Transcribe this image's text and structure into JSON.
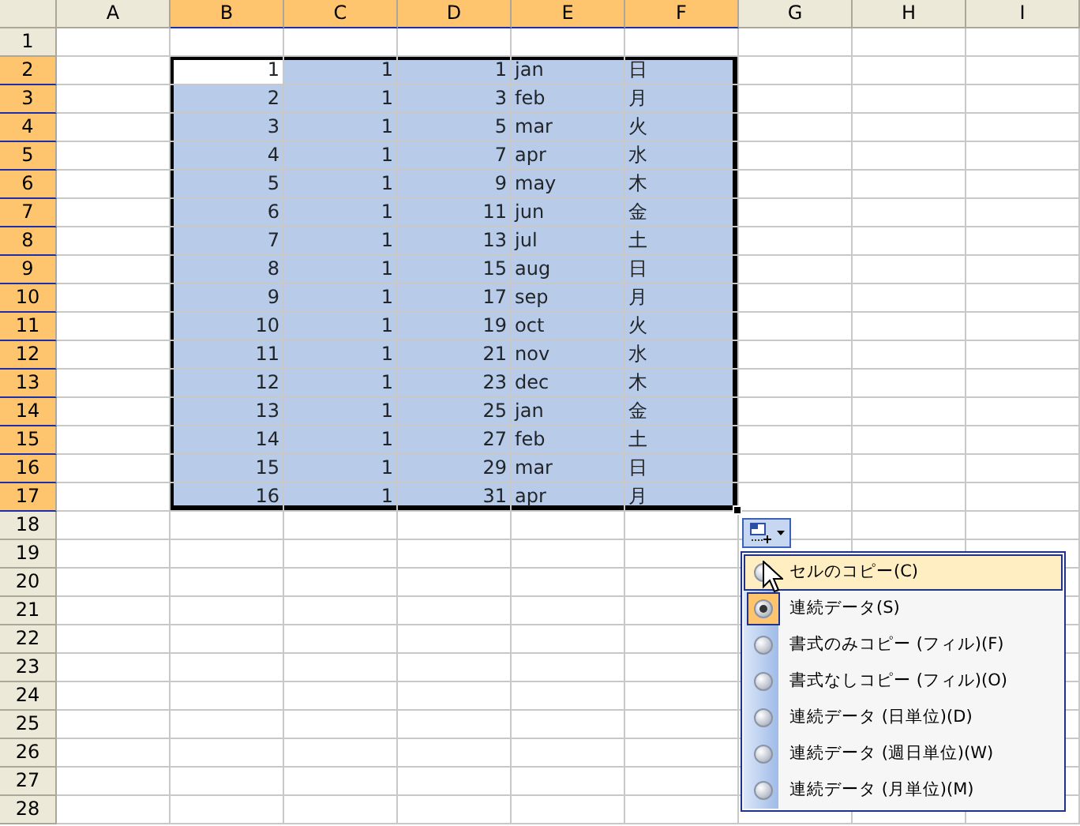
{
  "columns": [
    {
      "label": "A",
      "selected": false
    },
    {
      "label": "B",
      "selected": true
    },
    {
      "label": "C",
      "selected": true
    },
    {
      "label": "D",
      "selected": true
    },
    {
      "label": "E",
      "selected": true
    },
    {
      "label": "F",
      "selected": true
    },
    {
      "label": "G",
      "selected": false
    },
    {
      "label": "H",
      "selected": false
    },
    {
      "label": "I",
      "selected": false
    }
  ],
  "rows": [
    {
      "label": "1",
      "selected": false
    },
    {
      "label": "2",
      "selected": true,
      "cells": [
        {
          "text": "1",
          "kind": "number",
          "selected": true,
          "active": true
        },
        {
          "text": "1",
          "kind": "number",
          "selected": true,
          "active": false
        },
        {
          "text": "1",
          "kind": "number",
          "selected": true,
          "active": false
        },
        {
          "text": "jan",
          "kind": "text",
          "selected": true,
          "active": false
        },
        {
          "text": "日",
          "kind": "text",
          "selected": true,
          "active": false
        }
      ]
    },
    {
      "label": "3",
      "selected": true,
      "cells": [
        {
          "text": "2",
          "kind": "number",
          "selected": true,
          "active": false
        },
        {
          "text": "1",
          "kind": "number",
          "selected": true,
          "active": false
        },
        {
          "text": "3",
          "kind": "number",
          "selected": true,
          "active": false
        },
        {
          "text": "feb",
          "kind": "text",
          "selected": true,
          "active": false
        },
        {
          "text": "月",
          "kind": "text",
          "selected": true,
          "active": false
        }
      ]
    },
    {
      "label": "4",
      "selected": true,
      "cells": [
        {
          "text": "3",
          "kind": "number",
          "selected": true,
          "active": false
        },
        {
          "text": "1",
          "kind": "number",
          "selected": true,
          "active": false
        },
        {
          "text": "5",
          "kind": "number",
          "selected": true,
          "active": false
        },
        {
          "text": "mar",
          "kind": "text",
          "selected": true,
          "active": false
        },
        {
          "text": "火",
          "kind": "text",
          "selected": true,
          "active": false
        }
      ]
    },
    {
      "label": "5",
      "selected": true,
      "cells": [
        {
          "text": "4",
          "kind": "number",
          "selected": true,
          "active": false
        },
        {
          "text": "1",
          "kind": "number",
          "selected": true,
          "active": false
        },
        {
          "text": "7",
          "kind": "number",
          "selected": true,
          "active": false
        },
        {
          "text": "apr",
          "kind": "text",
          "selected": true,
          "active": false
        },
        {
          "text": "水",
          "kind": "text",
          "selected": true,
          "active": false
        }
      ]
    },
    {
      "label": "6",
      "selected": true,
      "cells": [
        {
          "text": "5",
          "kind": "number",
          "selected": true,
          "active": false
        },
        {
          "text": "1",
          "kind": "number",
          "selected": true,
          "active": false
        },
        {
          "text": "9",
          "kind": "number",
          "selected": true,
          "active": false
        },
        {
          "text": "may",
          "kind": "text",
          "selected": true,
          "active": false
        },
        {
          "text": "木",
          "kind": "text",
          "selected": true,
          "active": false
        }
      ]
    },
    {
      "label": "7",
      "selected": true,
      "cells": [
        {
          "text": "6",
          "kind": "number",
          "selected": true,
          "active": false
        },
        {
          "text": "1",
          "kind": "number",
          "selected": true,
          "active": false
        },
        {
          "text": "11",
          "kind": "number",
          "selected": true,
          "active": false
        },
        {
          "text": "jun",
          "kind": "text",
          "selected": true,
          "active": false
        },
        {
          "text": "金",
          "kind": "text",
          "selected": true,
          "active": false
        }
      ]
    },
    {
      "label": "8",
      "selected": true,
      "cells": [
        {
          "text": "7",
          "kind": "number",
          "selected": true,
          "active": false
        },
        {
          "text": "1",
          "kind": "number",
          "selected": true,
          "active": false
        },
        {
          "text": "13",
          "kind": "number",
          "selected": true,
          "active": false
        },
        {
          "text": "jul",
          "kind": "text",
          "selected": true,
          "active": false
        },
        {
          "text": "土",
          "kind": "text",
          "selected": true,
          "active": false
        }
      ]
    },
    {
      "label": "9",
      "selected": true,
      "cells": [
        {
          "text": "8",
          "kind": "number",
          "selected": true,
          "active": false
        },
        {
          "text": "1",
          "kind": "number",
          "selected": true,
          "active": false
        },
        {
          "text": "15",
          "kind": "number",
          "selected": true,
          "active": false
        },
        {
          "text": "aug",
          "kind": "text",
          "selected": true,
          "active": false
        },
        {
          "text": "日",
          "kind": "text",
          "selected": true,
          "active": false
        }
      ]
    },
    {
      "label": "10",
      "selected": true,
      "cells": [
        {
          "text": "9",
          "kind": "number",
          "selected": true,
          "active": false
        },
        {
          "text": "1",
          "kind": "number",
          "selected": true,
          "active": false
        },
        {
          "text": "17",
          "kind": "number",
          "selected": true,
          "active": false
        },
        {
          "text": "sep",
          "kind": "text",
          "selected": true,
          "active": false
        },
        {
          "text": "月",
          "kind": "text",
          "selected": true,
          "active": false
        }
      ]
    },
    {
      "label": "11",
      "selected": true,
      "cells": [
        {
          "text": "10",
          "kind": "number",
          "selected": true,
          "active": false
        },
        {
          "text": "1",
          "kind": "number",
          "selected": true,
          "active": false
        },
        {
          "text": "19",
          "kind": "number",
          "selected": true,
          "active": false
        },
        {
          "text": "oct",
          "kind": "text",
          "selected": true,
          "active": false
        },
        {
          "text": "火",
          "kind": "text",
          "selected": true,
          "active": false
        }
      ]
    },
    {
      "label": "12",
      "selected": true,
      "cells": [
        {
          "text": "11",
          "kind": "number",
          "selected": true,
          "active": false
        },
        {
          "text": "1",
          "kind": "number",
          "selected": true,
          "active": false
        },
        {
          "text": "21",
          "kind": "number",
          "selected": true,
          "active": false
        },
        {
          "text": "nov",
          "kind": "text",
          "selected": true,
          "active": false
        },
        {
          "text": "水",
          "kind": "text",
          "selected": true,
          "active": false
        }
      ]
    },
    {
      "label": "13",
      "selected": true,
      "cells": [
        {
          "text": "12",
          "kind": "number",
          "selected": true,
          "active": false
        },
        {
          "text": "1",
          "kind": "number",
          "selected": true,
          "active": false
        },
        {
          "text": "23",
          "kind": "number",
          "selected": true,
          "active": false
        },
        {
          "text": "dec",
          "kind": "text",
          "selected": true,
          "active": false
        },
        {
          "text": "木",
          "kind": "text",
          "selected": true,
          "active": false
        }
      ]
    },
    {
      "label": "14",
      "selected": true,
      "cells": [
        {
          "text": "13",
          "kind": "number",
          "selected": true,
          "active": false
        },
        {
          "text": "1",
          "kind": "number",
          "selected": true,
          "active": false
        },
        {
          "text": "25",
          "kind": "number",
          "selected": true,
          "active": false
        },
        {
          "text": "jan",
          "kind": "text",
          "selected": true,
          "active": false
        },
        {
          "text": "金",
          "kind": "text",
          "selected": true,
          "active": false
        }
      ]
    },
    {
      "label": "15",
      "selected": true,
      "cells": [
        {
          "text": "14",
          "kind": "number",
          "selected": true,
          "active": false
        },
        {
          "text": "1",
          "kind": "number",
          "selected": true,
          "active": false
        },
        {
          "text": "27",
          "kind": "number",
          "selected": true,
          "active": false
        },
        {
          "text": "feb",
          "kind": "text",
          "selected": true,
          "active": false
        },
        {
          "text": "土",
          "kind": "text",
          "selected": true,
          "active": false
        }
      ]
    },
    {
      "label": "16",
      "selected": true,
      "cells": [
        {
          "text": "15",
          "kind": "number",
          "selected": true,
          "active": false
        },
        {
          "text": "1",
          "kind": "number",
          "selected": true,
          "active": false
        },
        {
          "text": "29",
          "kind": "number",
          "selected": true,
          "active": false
        },
        {
          "text": "mar",
          "kind": "text",
          "selected": true,
          "active": false
        },
        {
          "text": "日",
          "kind": "text",
          "selected": true,
          "active": false
        }
      ]
    },
    {
      "label": "17",
      "selected": true,
      "cells": [
        {
          "text": "16",
          "kind": "number",
          "selected": true,
          "active": false
        },
        {
          "text": "1",
          "kind": "number",
          "selected": true,
          "active": false
        },
        {
          "text": "31",
          "kind": "number",
          "selected": true,
          "active": false
        },
        {
          "text": "apr",
          "kind": "text",
          "selected": true,
          "active": false
        },
        {
          "text": "月",
          "kind": "text",
          "selected": true,
          "active": false
        }
      ]
    },
    {
      "label": "18",
      "selected": false
    },
    {
      "label": "19",
      "selected": false
    },
    {
      "label": "20",
      "selected": false
    },
    {
      "label": "21",
      "selected": false
    },
    {
      "label": "22",
      "selected": false
    },
    {
      "label": "23",
      "selected": false
    },
    {
      "label": "24",
      "selected": false
    },
    {
      "label": "25",
      "selected": false
    },
    {
      "label": "26",
      "selected": false
    },
    {
      "label": "27",
      "selected": false
    },
    {
      "label": "28",
      "selected": false
    }
  ],
  "fill_options": {
    "items": [
      {
        "label": "セルのコピー(C)",
        "selected": false,
        "hovered": true
      },
      {
        "label": "連続データ(S)",
        "selected": true,
        "hovered": false
      },
      {
        "label": "書式のみコピー (フィル)(F)",
        "selected": false,
        "hovered": false
      },
      {
        "label": "書式なしコピー (フィル)(O)",
        "selected": false,
        "hovered": false
      },
      {
        "label": "連続データ (日単位)(D)",
        "selected": false,
        "hovered": false
      },
      {
        "label": "連続データ (週日単位)(W)",
        "selected": false,
        "hovered": false
      },
      {
        "label": "連続データ (月単位)(M)",
        "selected": false,
        "hovered": false
      }
    ]
  }
}
